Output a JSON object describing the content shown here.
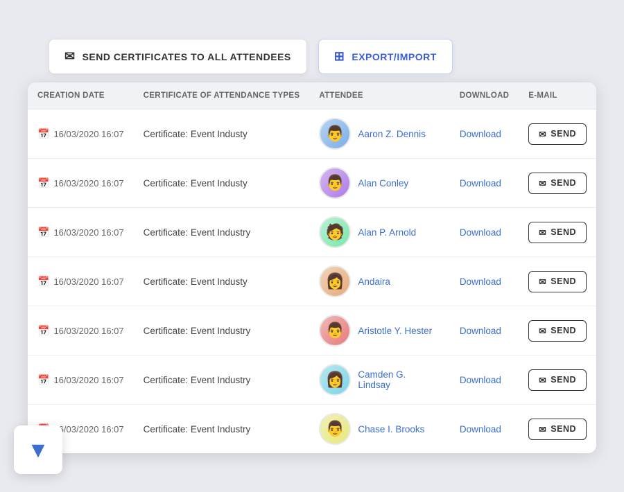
{
  "topButtons": {
    "sendLabel": "SEND CERTIFICATES TO ALL ATTENDEES",
    "exportLabel": "EXPORT/IMPORT"
  },
  "table": {
    "headers": {
      "creationDate": "CREATION DATE",
      "certificateType": "CERTIFICATE OF ATTENDANCE TYPES",
      "attendee": "ATTENDEE",
      "download": "DOWNLOAD",
      "email": "E-MAIL"
    },
    "rows": [
      {
        "date": "16/03/2020 16:07",
        "certificate": "Certificate: Event Industy",
        "name": "Aaron Z. Dennis",
        "avatarClass": "av1",
        "avatarEmoji": "👨"
      },
      {
        "date": "16/03/2020 16:07",
        "certificate": "Certificate: Event Industy",
        "name": "Alan Conley",
        "avatarClass": "av2",
        "avatarEmoji": "👨"
      },
      {
        "date": "16/03/2020 16:07",
        "certificate": "Certificate: Event Industry",
        "name": "Alan P. Arnold",
        "avatarClass": "av3",
        "avatarEmoji": "🧑"
      },
      {
        "date": "16/03/2020 16:07",
        "certificate": "Certificate: Event Industy",
        "name": "Andaira",
        "avatarClass": "av4",
        "avatarEmoji": "👩"
      },
      {
        "date": "16/03/2020 16:07",
        "certificate": "Certificate: Event Industry",
        "name": "Aristotle Y. Hester",
        "avatarClass": "av5",
        "avatarEmoji": "👨"
      },
      {
        "date": "16/03/2020 16:07",
        "certificate": "Certificate: Event Industry",
        "name": "Camden G. Lindsay",
        "avatarClass": "av6",
        "avatarEmoji": "👩"
      },
      {
        "date": "16/03/2020 16:07",
        "certificate": "Certificate: Event Industry",
        "name": "Chase I. Brooks",
        "avatarClass": "av7",
        "avatarEmoji": "👨"
      }
    ],
    "downloadLabel": "Download",
    "sendLabel": "SEND"
  }
}
